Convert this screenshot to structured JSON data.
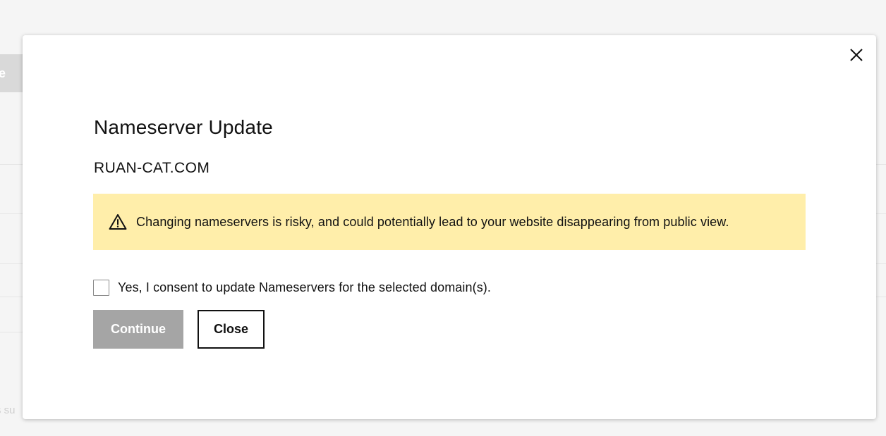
{
  "background": {
    "tab_fragment": "e",
    "footer_fragment": "s su"
  },
  "modal": {
    "title": "Nameserver Update",
    "domain": "RUAN-CAT.COM",
    "close_icon": "close-icon",
    "warning": {
      "icon": "warning-triangle-icon",
      "text": "Changing nameservers is risky, and could potentially lead to your website disappearing from public view.",
      "background_color": "#ffeeaa"
    },
    "consent": {
      "checked": false,
      "label": "Yes, I consent to update Nameservers for the selected domain(s)."
    },
    "buttons": {
      "continue_label": "Continue",
      "continue_disabled": true,
      "close_label": "Close"
    }
  }
}
